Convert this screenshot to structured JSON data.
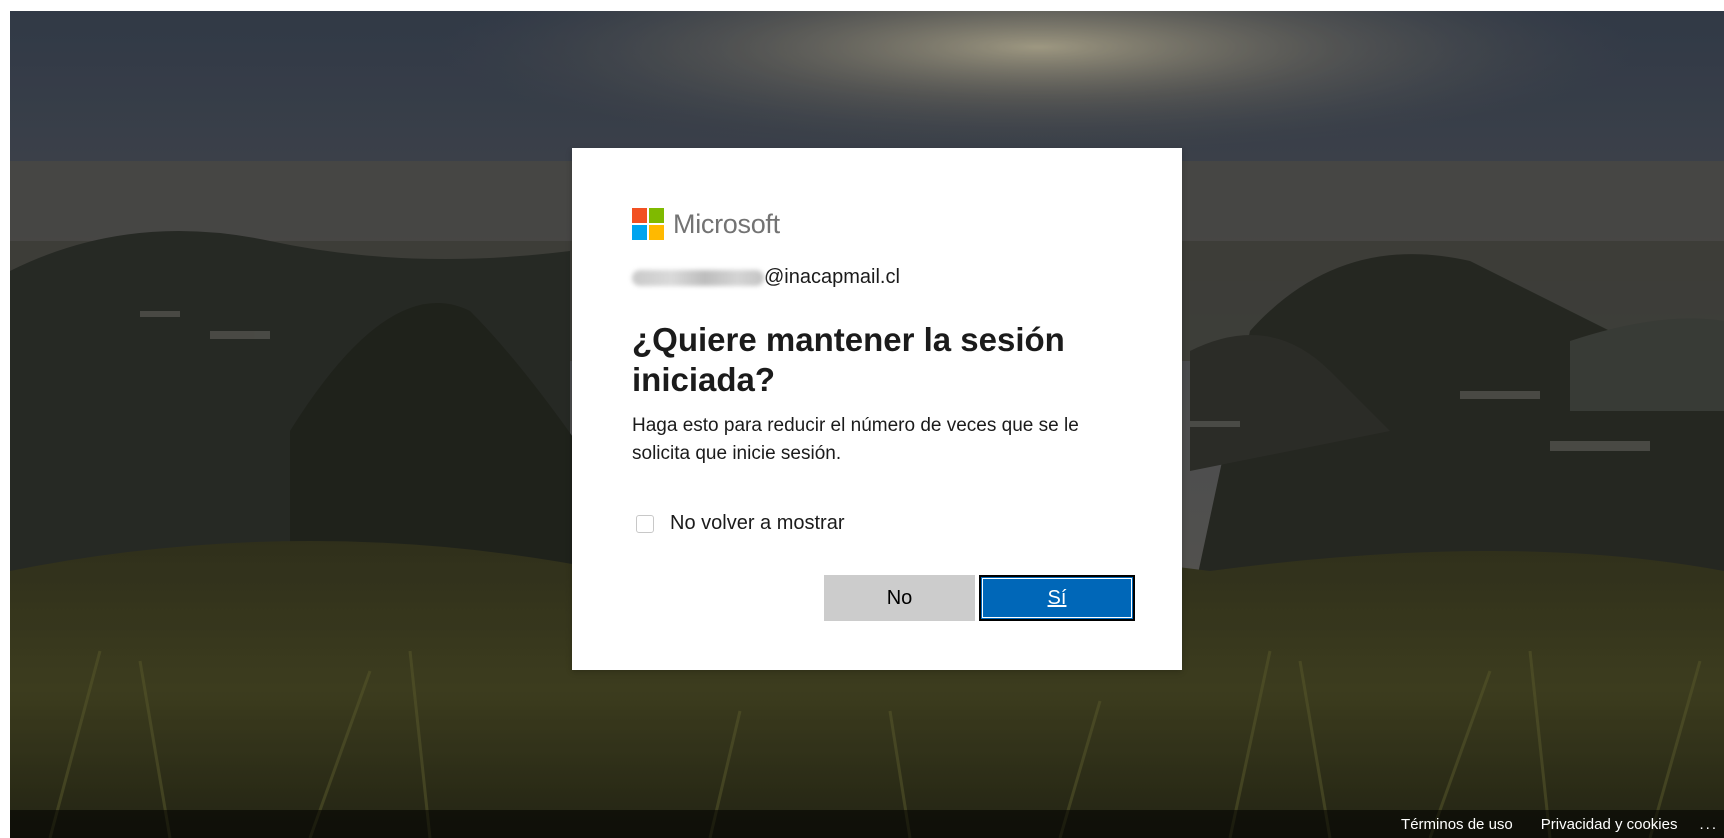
{
  "brand": {
    "name": "Microsoft",
    "logo_colors": [
      "#f25022",
      "#7fba00",
      "#00a4ef",
      "#ffb900"
    ]
  },
  "identity": {
    "email_domain": "@inacapmail.cl"
  },
  "prompt": {
    "title": "¿Quiere mantener la sesión iniciada?",
    "description": "Haga esto para reducir el número de veces que se le solicita que inicie sesión."
  },
  "checkbox": {
    "label": "No volver a mostrar",
    "checked": false
  },
  "buttons": {
    "no_label": "No",
    "yes_label": "Sí"
  },
  "footer": {
    "terms": "Términos de uso",
    "privacy": "Privacidad y cookies",
    "more": "..."
  },
  "colors": {
    "primary_button": "#0067b8",
    "secondary_button": "#cccccc"
  }
}
